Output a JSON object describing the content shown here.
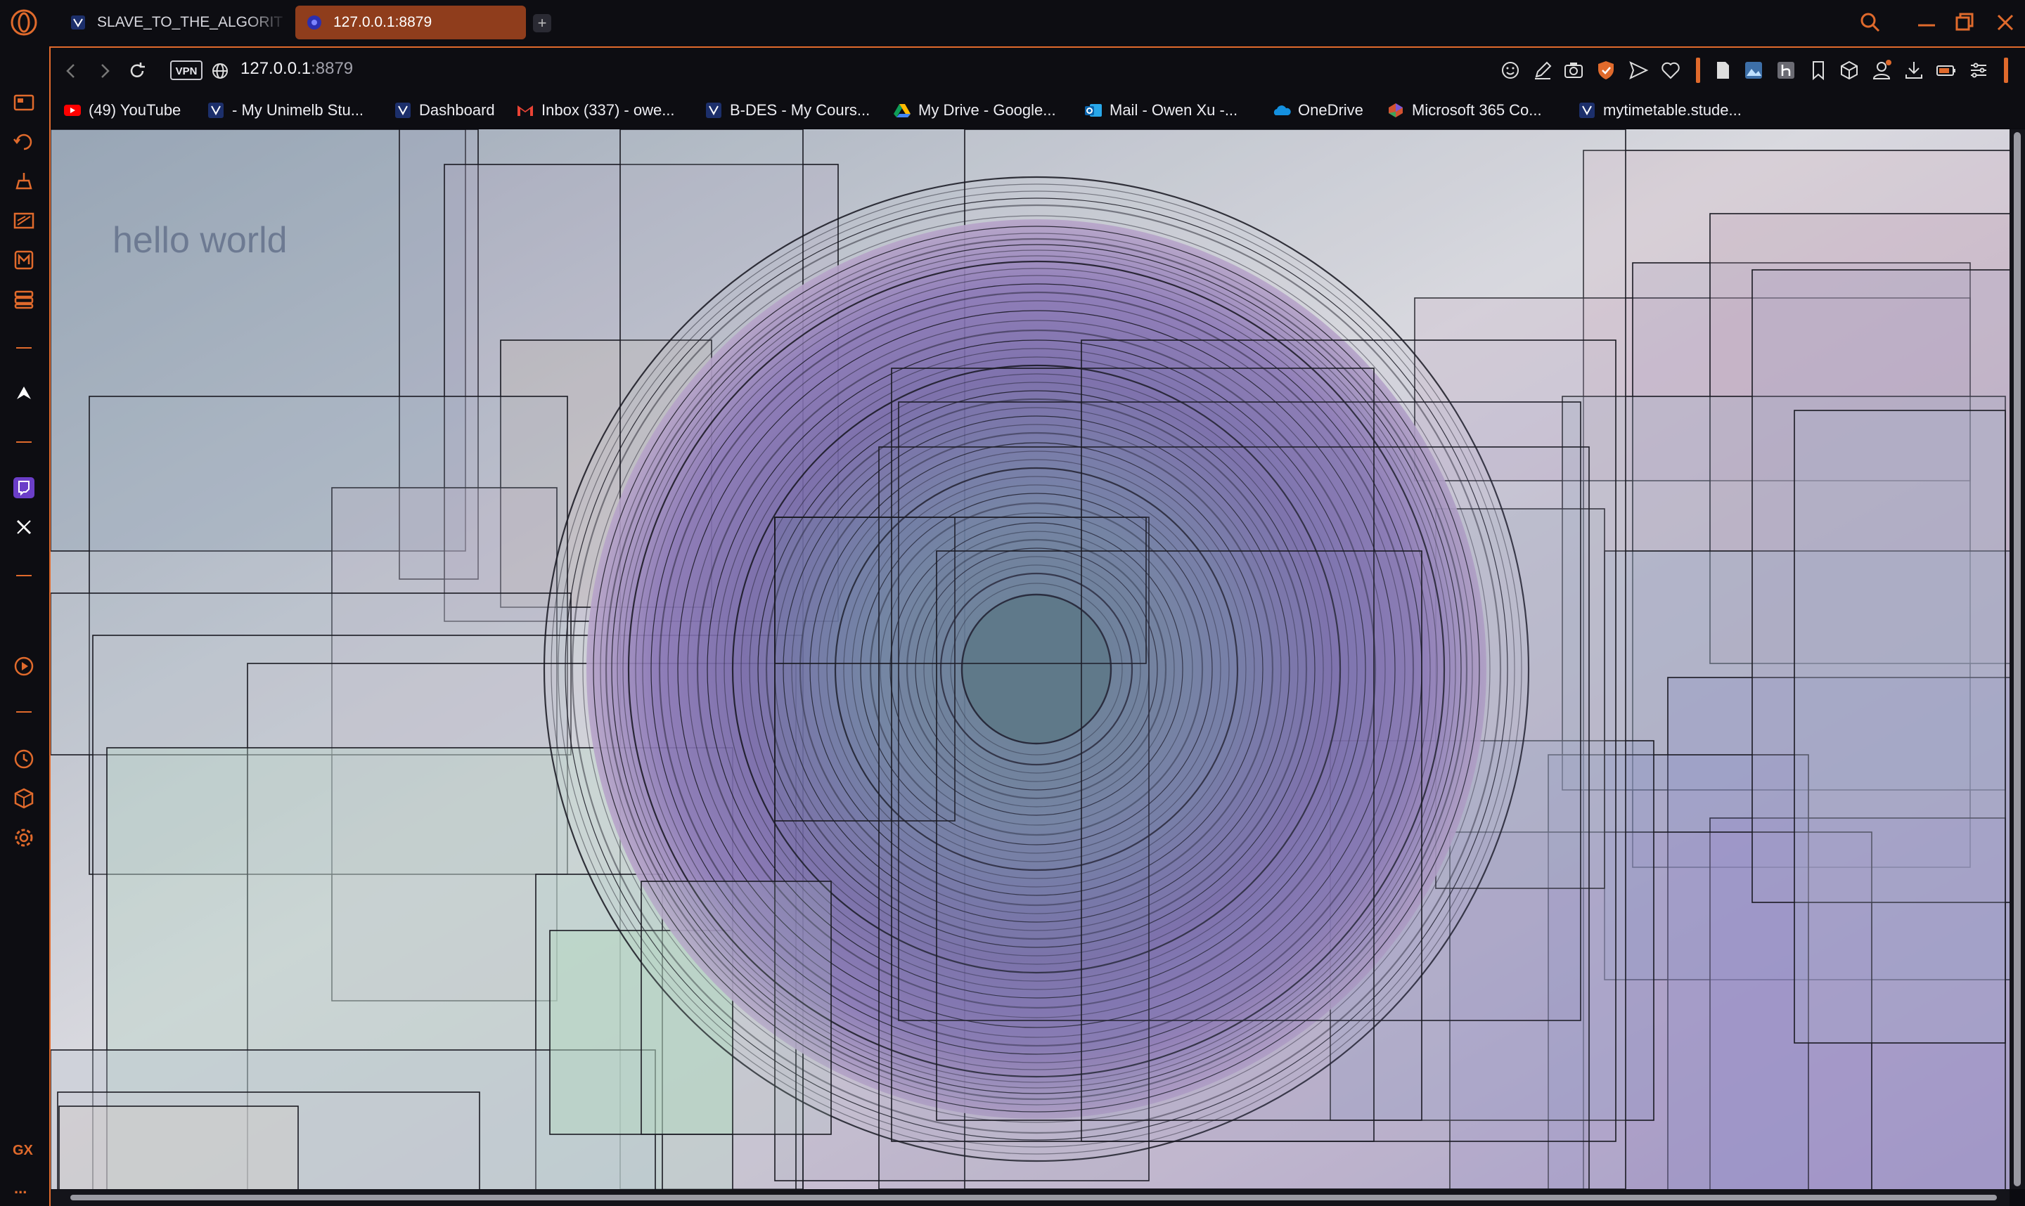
{
  "tabs": [
    {
      "label": "SLAVE_TO_THE_ALGORIT",
      "icon": "unimelb-icon",
      "active": false
    },
    {
      "label": "127.0.0.1:8879",
      "icon": "site-favicon-icon",
      "active": true
    }
  ],
  "address_bar": {
    "vpn_label": "VPN",
    "url_host": "127.0.0.1",
    "url_port": ":8879"
  },
  "bookmarks": [
    {
      "label": "(49) YouTube",
      "icon": "youtube-icon"
    },
    {
      "label": "- My Unimelb Stu...",
      "icon": "unimelb-icon"
    },
    {
      "label": "Dashboard",
      "icon": "unimelb-icon"
    },
    {
      "label": "Inbox (337) - owe...",
      "icon": "gmail-icon"
    },
    {
      "label": "B-DES - My Cours...",
      "icon": "unimelb-icon"
    },
    {
      "label": "My Drive - Google...",
      "icon": "google-drive-icon"
    },
    {
      "label": "Mail - Owen Xu -...",
      "icon": "outlook-icon"
    },
    {
      "label": "OneDrive",
      "icon": "onedrive-icon"
    },
    {
      "label": "Microsoft 365 Co...",
      "icon": "microsoft-365-icon"
    },
    {
      "label": "mytimetable.stude...",
      "icon": "unimelb-icon"
    }
  ],
  "sidebar": {
    "items": [
      "speed-dial-icon",
      "history-icon",
      "cleaner-icon",
      "gx-control-icon",
      "music-player-icon",
      "pinboard-icon",
      "aria-icon",
      "twitch-icon",
      "x-twitter-icon",
      "player-icon",
      "clock-icon",
      "extensions-icon",
      "settings-icon"
    ],
    "gx_label": "GX",
    "more_label": "..."
  },
  "page": {
    "text": "hello world"
  },
  "colors": {
    "accent": "#e06a2c",
    "active_tab": "#8f3d1c",
    "chrome_bg": "#0d0d12"
  }
}
